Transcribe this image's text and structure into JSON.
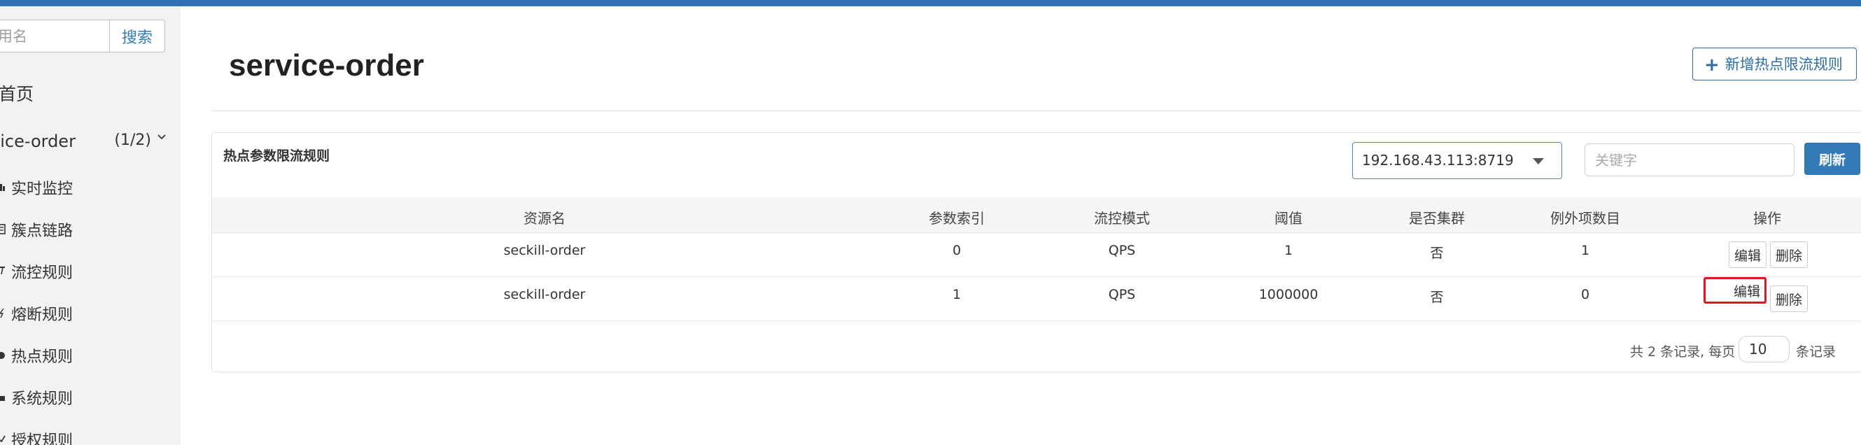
{
  "sidebar": {
    "search_placeholder": "用名",
    "search_button": "搜索",
    "home": "首页",
    "app": {
      "name": "vice-order",
      "count": "(1/2)"
    },
    "menu": [
      {
        "label": "实时监控",
        "icon": "bar-chart-icon"
      },
      {
        "label": "簇点链路",
        "icon": "list-icon"
      },
      {
        "label": "流控规则",
        "icon": "filter-icon"
      },
      {
        "label": "熔断规则",
        "icon": "flash-icon"
      },
      {
        "label": "热点规则",
        "icon": "fire-icon"
      },
      {
        "label": "系统规则",
        "icon": "lock-icon"
      },
      {
        "label": "授权规则",
        "icon": "check-icon"
      }
    ]
  },
  "header": {
    "title": "service-order",
    "add_button": "新增热点限流规则"
  },
  "panel": {
    "title": "热点参数限流规则",
    "machine": "192.168.43.113:8719",
    "keyword_placeholder": "关键字",
    "refresh_button": "刷新"
  },
  "table": {
    "headers": [
      "资源名",
      "参数索引",
      "流控模式",
      "阈值",
      "是否集群",
      "例外项数目",
      "操作"
    ],
    "rows": [
      {
        "resource": "seckill-order",
        "param_index": "0",
        "mode": "QPS",
        "threshold": "1",
        "cluster": "否",
        "exceptions": "1",
        "edit": "编辑",
        "delete": "删除"
      },
      {
        "resource": "seckill-order",
        "param_index": "1",
        "mode": "QPS",
        "threshold": "1000000",
        "cluster": "否",
        "exceptions": "0",
        "edit": "编辑",
        "delete": "删除"
      }
    ]
  },
  "pagination": {
    "summary": "共 2 条记录, 每页",
    "page_size": "10",
    "suffix": "条记录"
  },
  "colors": {
    "topbar": "#2f72b8",
    "primary": "#337ab7",
    "highlight": "#e0191f",
    "sidebar_bg": "#f2f2f2"
  }
}
